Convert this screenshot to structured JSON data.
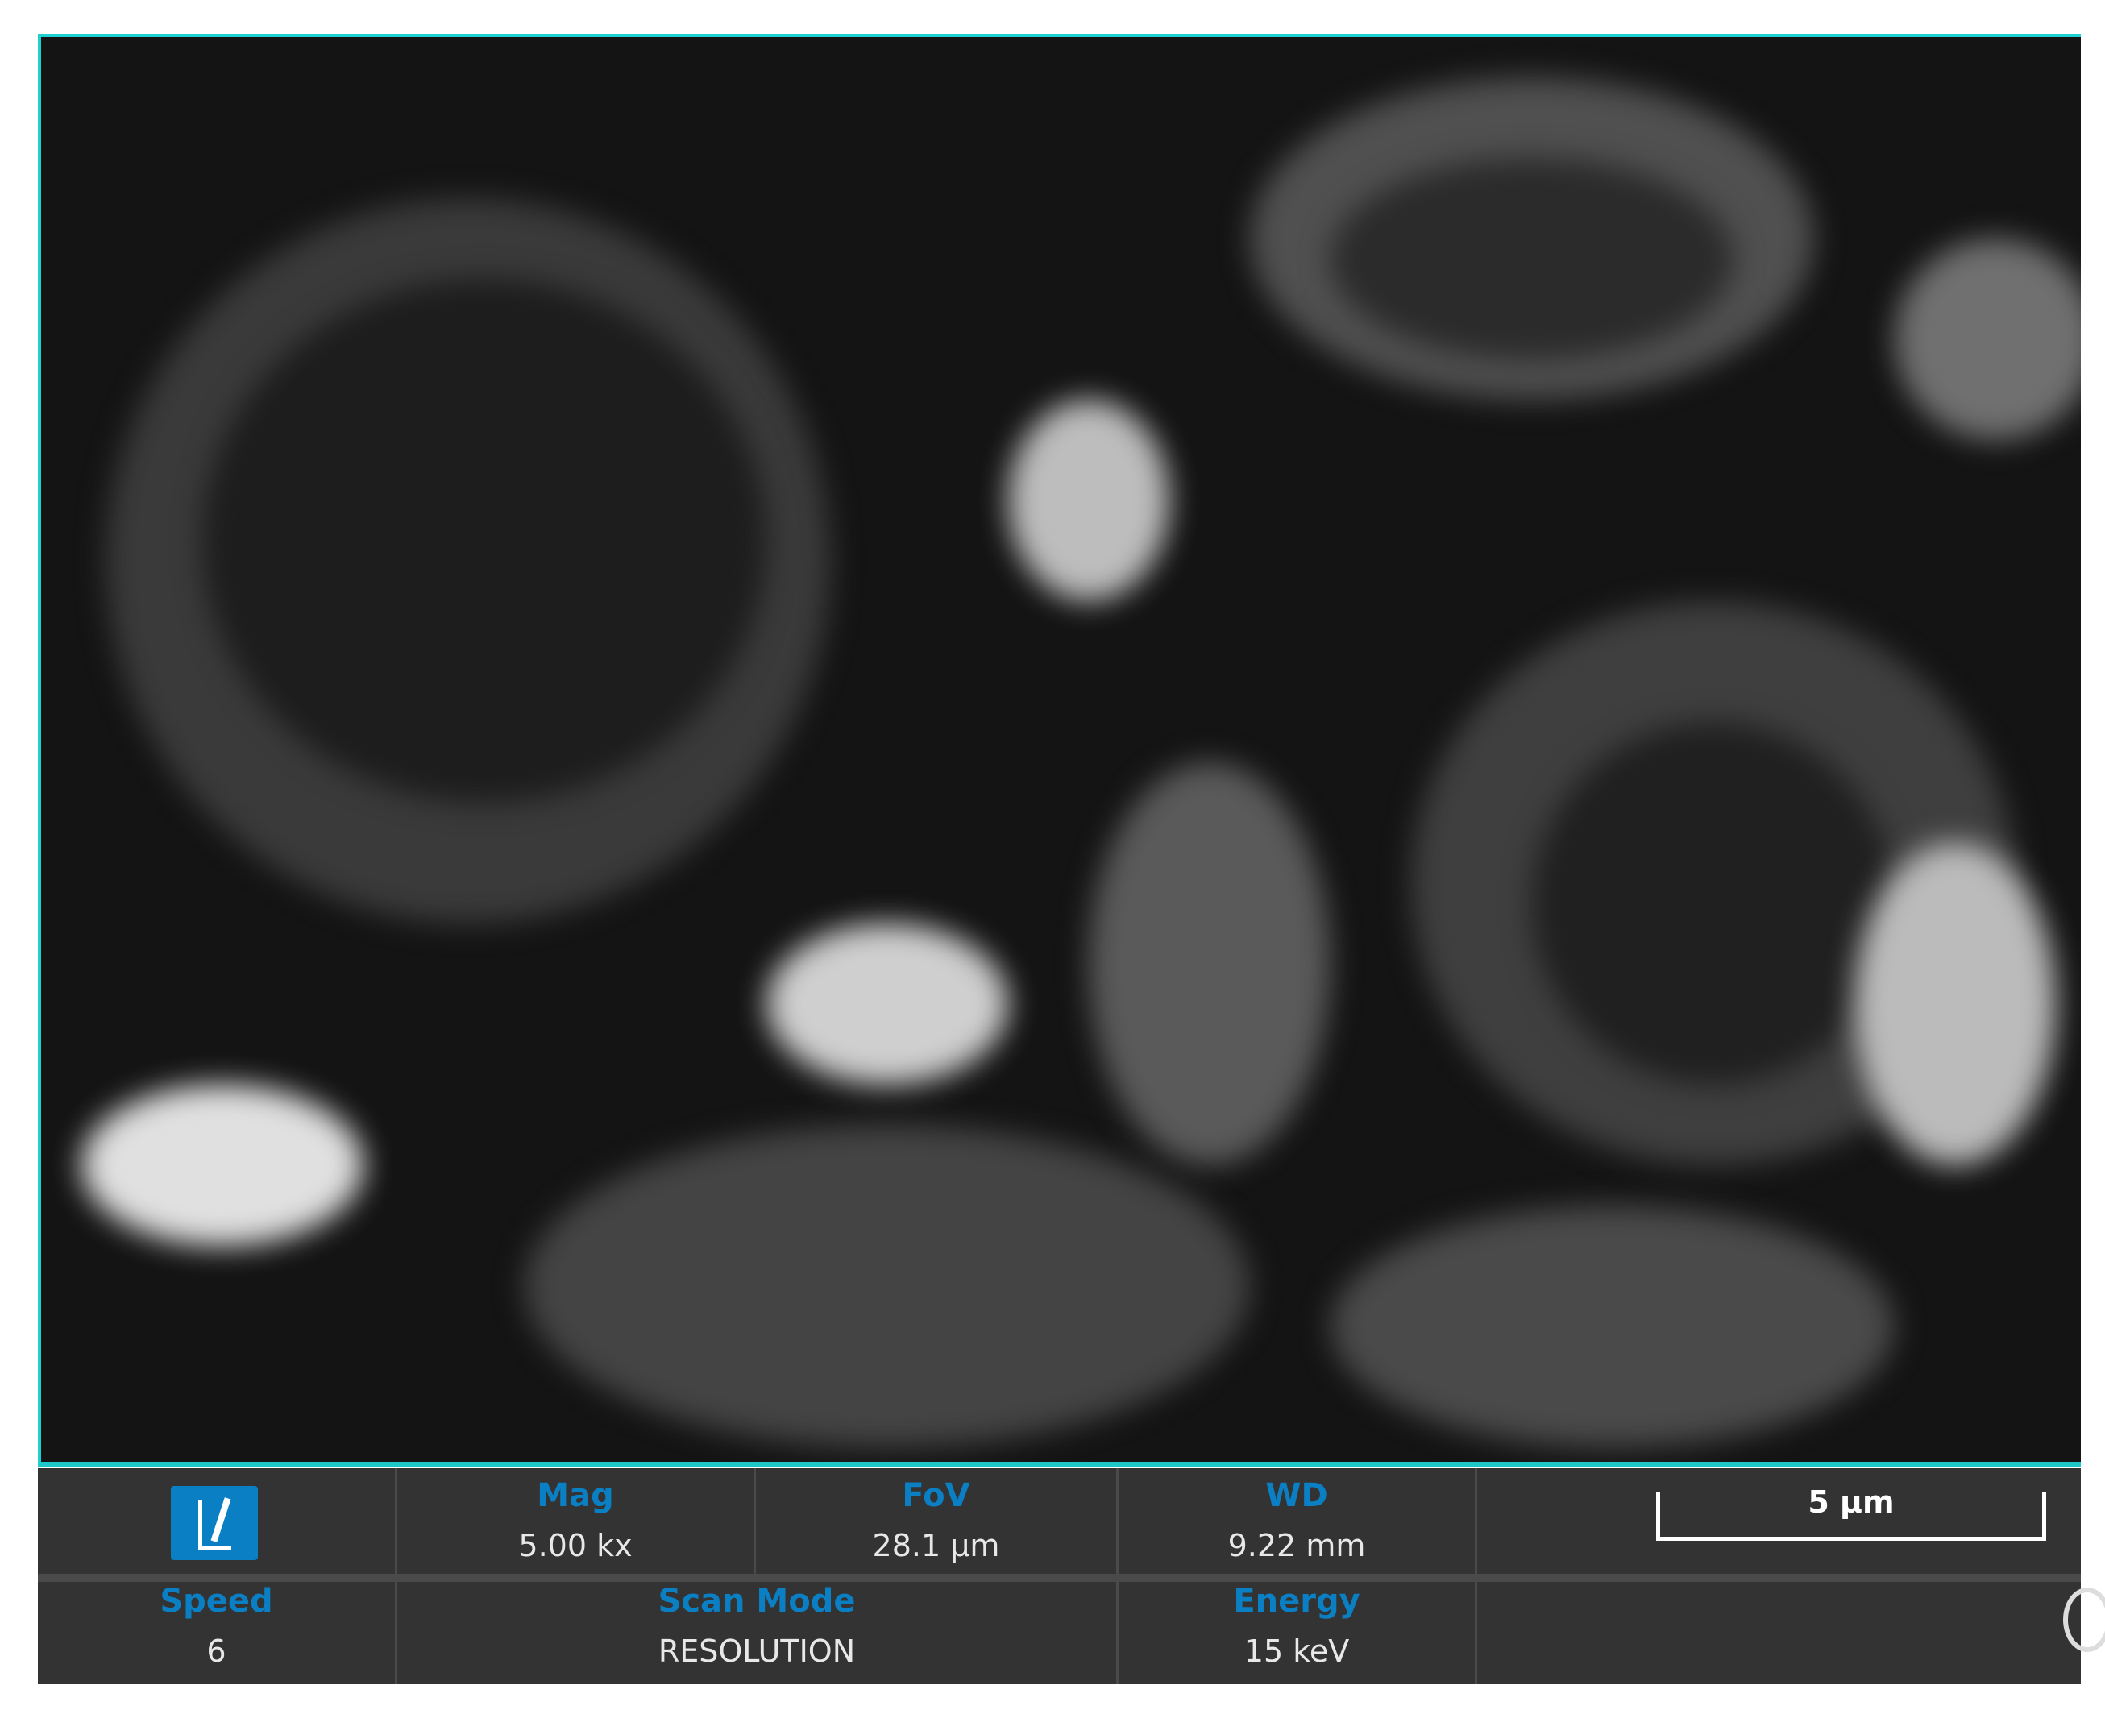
{
  "info_bar": {
    "mag": {
      "label": "Mag",
      "value": "5.00 kx"
    },
    "fov": {
      "label": "FoV",
      "value": "28.1 μm"
    },
    "wd": {
      "label": "WD",
      "value": "9.22 mm"
    },
    "speed": {
      "label": "Speed",
      "value": "6"
    },
    "scan_mode": {
      "label": "Scan Mode",
      "value": "RESOLUTION"
    },
    "energy": {
      "label": "Energy",
      "value": "15 keV"
    },
    "scale_bar": "5 μm"
  },
  "colors": {
    "accent": "#0a7fc4",
    "frame": "#1fd0d0",
    "panel": "#333333"
  }
}
